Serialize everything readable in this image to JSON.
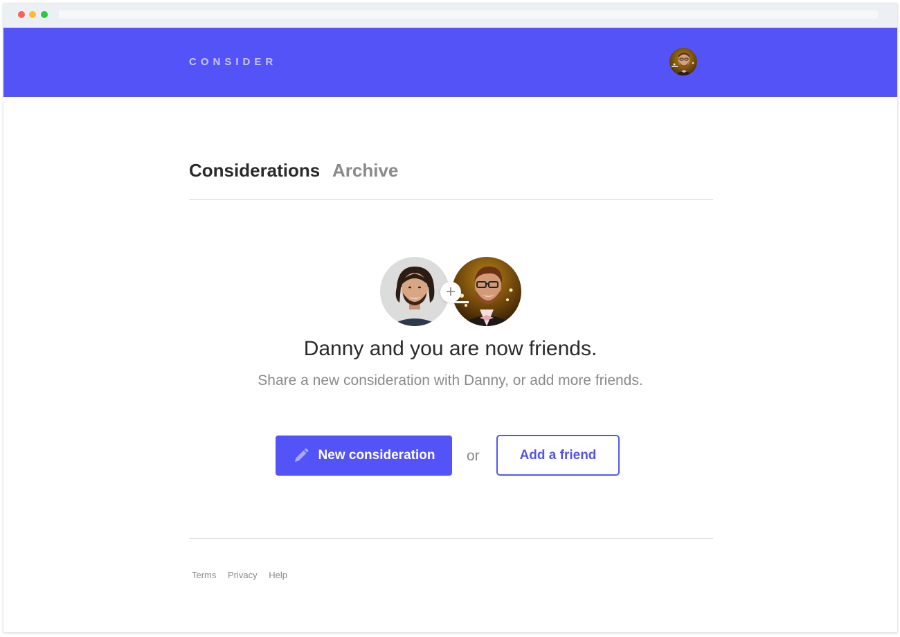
{
  "browser": {
    "traffic_lights": [
      "close",
      "minimize",
      "maximize"
    ]
  },
  "header": {
    "logo": "CONSIDER",
    "brand_color": "#5353f7",
    "user_avatar": "user-avatar"
  },
  "tabs": [
    {
      "label": "Considerations",
      "active": true
    },
    {
      "label": "Archive",
      "active": false
    }
  ],
  "empty_state": {
    "avatars": [
      "danny-avatar",
      "user-avatar"
    ],
    "connector_icon": "plus-icon",
    "headline": "Danny and you are now friends.",
    "subline": "Share a new consideration with Danny, or add more friends."
  },
  "actions": {
    "primary": {
      "label": "New consideration",
      "icon": "pencil-icon"
    },
    "separator": "or",
    "secondary": {
      "label": "Add a friend"
    }
  },
  "footer": {
    "links": [
      "Terms",
      "Privacy",
      "Help"
    ]
  }
}
